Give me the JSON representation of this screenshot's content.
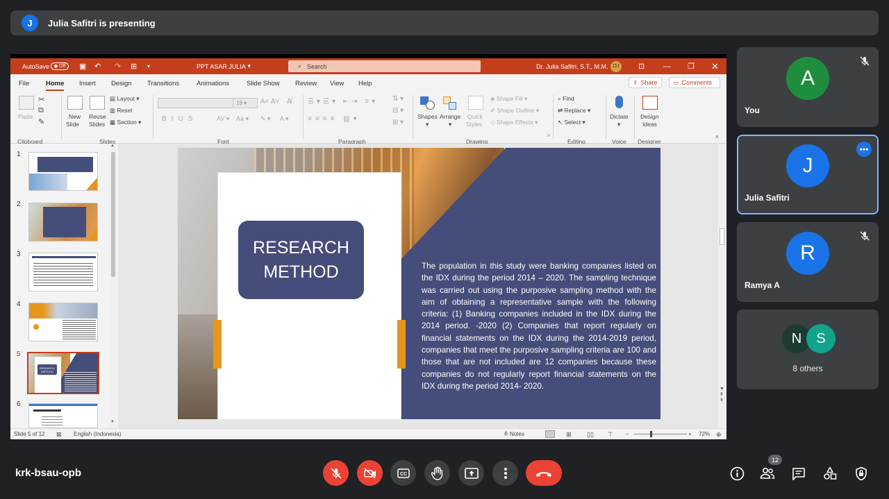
{
  "presenting_bar": {
    "avatar_letter": "J",
    "text": "Julia Safitri is presenting"
  },
  "ppt": {
    "titlebar": {
      "autosave_label": "AutoSave",
      "autosave_state": "Off",
      "doc_title": "PPT ASAR JULIA",
      "search_placeholder": "Search",
      "user_name": "Dr. Julia Safitri, S.T., M.M.",
      "user_initials": "DJ"
    },
    "menu": [
      "File",
      "Home",
      "Insert",
      "Design",
      "Transitions",
      "Animations",
      "Slide Show",
      "Review",
      "View",
      "Help"
    ],
    "active_tab": "Home",
    "share_label": "Share",
    "comments_label": "Comments",
    "ribbon": {
      "clipboard": {
        "paste": "Paste",
        "group": "Clipboard"
      },
      "slides": {
        "new_slide_1": "New",
        "new_slide_2": "Slide",
        "reuse_1": "Reuse",
        "reuse_2": "Slides",
        "layout": "Layout",
        "reset": "Reset",
        "section": "Section",
        "group": "Slides"
      },
      "font": {
        "size": "18",
        "group": "Font"
      },
      "paragraph": {
        "group": "Paragraph"
      },
      "drawing": {
        "shapes": "Shapes",
        "arrange": "Arrange",
        "quick_1": "Quick",
        "quick_2": "Styles",
        "shape_fill": "Shape Fill",
        "shape_outline": "Shape Outline",
        "shape_effects": "Shape Effects",
        "group": "Drawing"
      },
      "editing": {
        "find": "Find",
        "replace": "Replace",
        "select": "Select",
        "group": "Editing"
      },
      "voice": {
        "dictate": "Dictate",
        "group": "Voice"
      },
      "designer": {
        "design_1": "Design",
        "design_2": "Ideas",
        "group": "Designer"
      }
    },
    "thumbnails": [
      {
        "num": "1"
      },
      {
        "num": "2"
      },
      {
        "num": "3"
      },
      {
        "num": "4"
      },
      {
        "num": "5"
      },
      {
        "num": "6"
      }
    ],
    "selected_slide": "5",
    "slide": {
      "title_line1": "RESEARCH",
      "title_line2": "METHOD",
      "body": "The population in this study were banking companies listed on the IDX during the period 2014 – 2020. The sampling technique was carried out using the purposive sampling method with the aim of obtaining a representative sample with the following criteria: (1) Banking companies included in the IDX during the 2014 period. -2020 (2) Companies that report regularly on financial statements on the IDX during the 2014-2019 period, companies that meet the purposive sampling criteria are 100 and those that are not included are 12 companies because these companies do not regularly report financial statements on the IDX during the period 2014- 2020.",
      "thumb5_label": "RESEARCH METHOD"
    },
    "statusbar": {
      "slide_info": "Slide 5 of 12",
      "language": "English (Indonesia)",
      "notes": "Notes",
      "zoom": "72%"
    }
  },
  "participants": [
    {
      "letter": "A",
      "name": "You",
      "color": "#1e8e3e",
      "muted": true
    },
    {
      "letter": "J",
      "name": "Julia Safitri",
      "color": "#1a73e8",
      "muted": false
    },
    {
      "letter": "R",
      "name": "Ramya A",
      "color": "#1a73e8",
      "muted": true
    }
  ],
  "others": {
    "letter1": "N",
    "letter2": "S",
    "label": "8 others"
  },
  "meeting": {
    "code": "krk-bsau-opb",
    "participant_count": "12"
  },
  "colors": {
    "accent_ppt": "#c43e1c",
    "meet_red": "#ea4335",
    "slide_navy": "#454d7a",
    "slide_orange": "#e8951c"
  }
}
